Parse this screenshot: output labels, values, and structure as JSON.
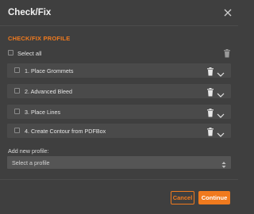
{
  "window": {
    "title": "Check/Fix"
  },
  "section": {
    "heading": "CHECK/FIX PROFILE",
    "select_all_label": "Select all"
  },
  "profiles": [
    {
      "label": "1.  Place Grommets"
    },
    {
      "label": "2.  Advanced Bleed"
    },
    {
      "label": "3.  Place Lines"
    },
    {
      "label": "4.  Create Contour from PDFBox"
    }
  ],
  "add_profile": {
    "label": "Add new profile:",
    "select_value": "Select a profile"
  },
  "footer": {
    "cancel_label": "Cancel",
    "continue_label": "Continue"
  },
  "colors": {
    "accent": "#f07a1e",
    "background": "#3f3f3f",
    "row_background": "#4a4a4a"
  },
  "icons": {
    "close": "close-icon",
    "trash": "trash-icon",
    "chevron": "chevron-down-icon",
    "select_arrows": "sort-arrows-icon"
  }
}
